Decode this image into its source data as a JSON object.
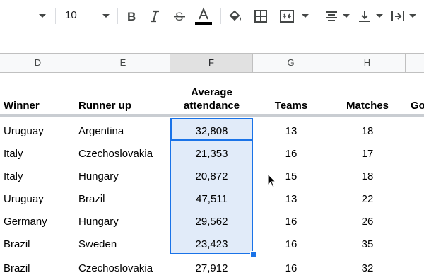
{
  "toolbar": {
    "font_size": "10",
    "icons": [
      "font-dropdown-chevron",
      "font-size-chevron",
      "bold-icon",
      "italic-icon",
      "strikethrough-icon",
      "text-color-icon",
      "fill-color-icon",
      "borders-icon",
      "merge-cells-icon",
      "horizontal-align-icon",
      "vertical-align-icon",
      "text-direction-icon"
    ],
    "text_color_underline": "#000000"
  },
  "columns": [
    {
      "letter": "D",
      "selected": false
    },
    {
      "letter": "E",
      "selected": false
    },
    {
      "letter": "F",
      "selected": true
    },
    {
      "letter": "G",
      "selected": false
    },
    {
      "letter": "H",
      "selected": false
    }
  ],
  "headers": {
    "winner": "Winner",
    "runner_up": "Runner up",
    "avg_line1": "Average",
    "avg_line2": "attendance",
    "teams": "Teams",
    "matches": "Matches",
    "goals_partial": "Go"
  },
  "rows": [
    {
      "winner": "Uruguay",
      "runner_up": "Argentina",
      "attendance": "32,808",
      "teams": "13",
      "matches": "18"
    },
    {
      "winner": "Italy",
      "runner_up": "Czechoslovakia",
      "attendance": "21,353",
      "teams": "16",
      "matches": "17"
    },
    {
      "winner": "Italy",
      "runner_up": "Hungary",
      "attendance": "20,872",
      "teams": "15",
      "matches": "18"
    },
    {
      "winner": "Uruguay",
      "runner_up": "Brazil",
      "attendance": "47,511",
      "teams": "13",
      "matches": "22"
    },
    {
      "winner": "Germany",
      "runner_up": "Hungary",
      "attendance": "29,562",
      "teams": "16",
      "matches": "26"
    },
    {
      "winner": "Brazil",
      "runner_up": "Sweden",
      "attendance": "23,423",
      "teams": "16",
      "matches": "35"
    },
    {
      "winner": "Brazil",
      "runner_up": "Czechoslovakia",
      "attendance": "27,912",
      "teams": "16",
      "matches": "32"
    }
  ],
  "colors": {
    "selection_border": "#1a73e8",
    "selection_fill": "#e3ecfb",
    "header_bg": "#f8f9fa"
  }
}
